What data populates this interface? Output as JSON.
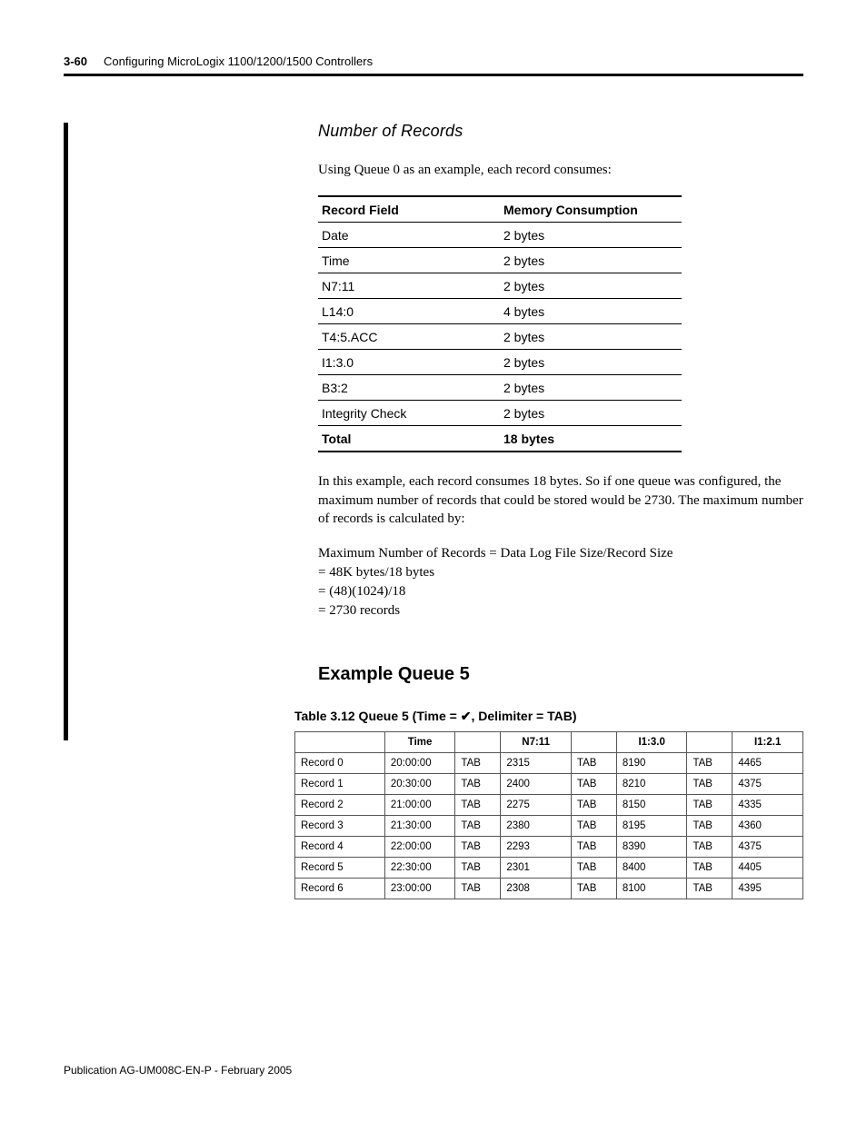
{
  "header": {
    "page_num": "3-60",
    "title": "Configuring MicroLogix 1100/1200/1500 Controllers"
  },
  "section1": {
    "heading": "Number of Records",
    "intro": "Using Queue 0 as an example, each record consumes:",
    "table_headers": {
      "col1": "Record Field",
      "col2": "Memory Consumption"
    },
    "rows": [
      {
        "field": "Date",
        "mem": "2 bytes"
      },
      {
        "field": "Time",
        "mem": "2 bytes"
      },
      {
        "field": "N7:11",
        "mem": "2 bytes"
      },
      {
        "field": "L14:0",
        "mem": "4 bytes"
      },
      {
        "field": "T4:5.ACC",
        "mem": "2 bytes"
      },
      {
        "field": "I1:3.0",
        "mem": "2 bytes"
      },
      {
        "field": "B3:2",
        "mem": "2 bytes"
      },
      {
        "field": "Integrity Check",
        "mem": "2 bytes"
      }
    ],
    "total": {
      "label": "Total",
      "value": "18 bytes"
    },
    "para2": "In this example, each record consumes 18 bytes. So if one queue was configured, the maximum number of records that could be stored would be 2730. The maximum number of records is calculated by:",
    "calc": {
      "l1": "Maximum Number of Records = Data Log File Size/Record Size",
      "l2": "= 48K bytes/18 bytes",
      "l3": "= (48)(1024)/18",
      "l4": "= 2730 records"
    }
  },
  "section2": {
    "heading": "Example Queue 5",
    "caption_pre": "Table 3.12 Queue 5 (Time = ",
    "caption_check": "✔",
    "caption_post": ", Delimiter = TAB)",
    "headers": {
      "time": "Time",
      "n7": "N7:11",
      "i13": "I1:3.0",
      "i12": "I1:2.1"
    },
    "tab": "TAB",
    "rows": [
      {
        "rec": "Record 0",
        "time": "20:00:00",
        "n7": "2315",
        "i13": "8190",
        "i12": "4465"
      },
      {
        "rec": "Record 1",
        "time": "20:30:00",
        "n7": "2400",
        "i13": "8210",
        "i12": "4375"
      },
      {
        "rec": "Record 2",
        "time": "21:00:00",
        "n7": "2275",
        "i13": "8150",
        "i12": "4335"
      },
      {
        "rec": "Record 3",
        "time": "21:30:00",
        "n7": "2380",
        "i13": "8195",
        "i12": "4360"
      },
      {
        "rec": "Record 4",
        "time": "22:00:00",
        "n7": "2293",
        "i13": "8390",
        "i12": "4375"
      },
      {
        "rec": "Record 5",
        "time": "22:30:00",
        "n7": "2301",
        "i13": "8400",
        "i12": "4405"
      },
      {
        "rec": "Record 6",
        "time": "23:00:00",
        "n7": "2308",
        "i13": "8100",
        "i12": "4395"
      }
    ]
  },
  "footer": "Publication AG-UM008C-EN-P - February 2005"
}
